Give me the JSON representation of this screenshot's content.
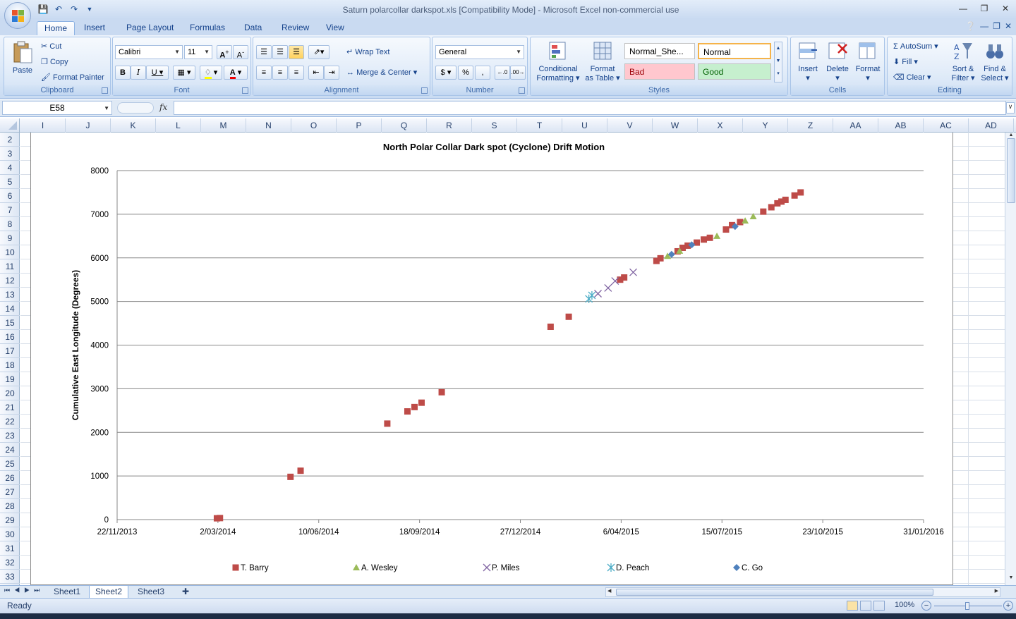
{
  "app": {
    "title": "Saturn polarcollar darkspot.xls  [Compatibility Mode] - Microsoft Excel non-commercial use"
  },
  "tabs": [
    "Home",
    "Insert",
    "Page Layout",
    "Formulas",
    "Data",
    "Review",
    "View"
  ],
  "ribbon": {
    "clipboard": {
      "label": "Clipboard",
      "paste": "Paste",
      "cut": "Cut",
      "copy": "Copy",
      "format_painter": "Format Painter"
    },
    "font": {
      "label": "Font",
      "name": "Calibri",
      "size": "11"
    },
    "alignment": {
      "label": "Alignment",
      "wrap": "Wrap Text",
      "merge": "Merge & Center"
    },
    "number": {
      "label": "Number",
      "format": "General"
    },
    "styles": {
      "label": "Styles",
      "conditional_1": "Conditional",
      "conditional_2": "Formatting",
      "format_table_1": "Format",
      "format_table_2": "as Table",
      "normal_sheet": "Normal_She...",
      "normal": "Normal",
      "bad": "Bad",
      "good": "Good"
    },
    "cells": {
      "label": "Cells",
      "insert": "Insert",
      "delete": "Delete",
      "format": "Format"
    },
    "editing": {
      "label": "Editing",
      "autosum": "AutoSum",
      "fill": "Fill",
      "clear": "Clear",
      "sort_1": "Sort &",
      "sort_2": "Filter",
      "find_1": "Find &",
      "find_2": "Select"
    }
  },
  "formula_bar": {
    "name_box": "E58",
    "fx": "fx",
    "value": ""
  },
  "columns": [
    "I",
    "J",
    "K",
    "L",
    "M",
    "N",
    "O",
    "P",
    "Q",
    "R",
    "S",
    "T",
    "U",
    "V",
    "W",
    "X",
    "Y",
    "Z",
    "AA",
    "AB",
    "AC",
    "AD"
  ],
  "rows": [
    "2",
    "3",
    "4",
    "5",
    "6",
    "7",
    "8",
    "9",
    "10",
    "11",
    "12",
    "13",
    "14",
    "15",
    "16",
    "17",
    "18",
    "19",
    "20",
    "21",
    "22",
    "23",
    "24",
    "25",
    "26",
    "27",
    "28",
    "29",
    "30",
    "31",
    "32",
    "33"
  ],
  "sheets": [
    "Sheet1",
    "Sheet2",
    "Sheet3"
  ],
  "active_sheet": "Sheet2",
  "status": {
    "mode": "Ready",
    "zoom": "100%"
  },
  "chart_data": {
    "type": "scatter",
    "title": "North Polar Collar Dark spot (Cyclone) Drift Motion",
    "xlabel": "",
    "ylabel": "Cumulative East Longitude (Degrees)",
    "x_ticks": [
      "22/11/2013",
      "2/03/2014",
      "10/06/2014",
      "18/09/2014",
      "27/12/2014",
      "6/04/2015",
      "15/07/2015",
      "23/10/2015",
      "31/01/2016"
    ],
    "xlim": [
      "22/11/2013",
      "31/01/2016"
    ],
    "ylim": [
      0,
      8000
    ],
    "y_ticks": [
      "0",
      "1000",
      "2000",
      "3000",
      "4000",
      "5000",
      "6000",
      "7000",
      "8000"
    ],
    "grid": "horizontal",
    "legend": "bottom",
    "series": [
      {
        "name": "T. Barry",
        "marker": "square",
        "color": "#be4b48",
        "points": [
          [
            "1/03/2014",
            30
          ],
          [
            "4/03/2014",
            35
          ],
          [
            "13/05/2014",
            980
          ],
          [
            "23/05/2014",
            1120
          ],
          [
            "17/08/2014",
            2200
          ],
          [
            "6/09/2014",
            2480
          ],
          [
            "13/09/2014",
            2580
          ],
          [
            "20/09/2014",
            2680
          ],
          [
            "10/10/2014",
            2920
          ],
          [
            "26/01/2015",
            4420
          ],
          [
            "13/02/2015",
            4650
          ],
          [
            "5/04/2015",
            5500
          ],
          [
            "9/04/2015",
            5550
          ],
          [
            "11/05/2015",
            5930
          ],
          [
            "15/05/2015",
            5990
          ],
          [
            "1/06/2015",
            6150
          ],
          [
            "6/06/2015",
            6230
          ],
          [
            "11/06/2015",
            6280
          ],
          [
            "20/06/2015",
            6350
          ],
          [
            "27/06/2015",
            6420
          ],
          [
            "3/07/2015",
            6460
          ],
          [
            "19/07/2015",
            6650
          ],
          [
            "25/07/2015",
            6750
          ],
          [
            "2/08/2015",
            6820
          ],
          [
            "25/08/2015",
            7060
          ],
          [
            "2/09/2015",
            7160
          ],
          [
            "8/09/2015",
            7250
          ],
          [
            "12/09/2015",
            7290
          ],
          [
            "16/09/2015",
            7330
          ],
          [
            "25/09/2015",
            7430
          ],
          [
            "1/10/2015",
            7500
          ]
        ]
      },
      {
        "name": "A. Wesley",
        "marker": "triangle",
        "color": "#9bbb59",
        "points": [
          [
            "22/05/2015",
            6040
          ],
          [
            "3/06/2015",
            6160
          ],
          [
            "10/07/2015",
            6500
          ],
          [
            "7/08/2015",
            6850
          ],
          [
            "15/08/2015",
            6950
          ]
        ]
      },
      {
        "name": "P. Miles",
        "marker": "x",
        "color": "#8064a2",
        "points": [
          [
            "14/03/2015",
            5180
          ],
          [
            "24/03/2015",
            5310
          ],
          [
            "31/03/2015",
            5470
          ],
          [
            "18/04/2015",
            5670
          ]
        ]
      },
      {
        "name": "D. Peach",
        "marker": "star",
        "color": "#4bacc6",
        "points": [
          [
            "5/03/2015",
            5060
          ],
          [
            "8/03/2015",
            5140
          ]
        ]
      },
      {
        "name": "C. Go",
        "marker": "diamond",
        "color": "#4f81bd",
        "points": [
          [
            "26/05/2015",
            6080
          ],
          [
            "15/06/2015",
            6300
          ],
          [
            "28/07/2015",
            6720
          ]
        ]
      }
    ]
  }
}
